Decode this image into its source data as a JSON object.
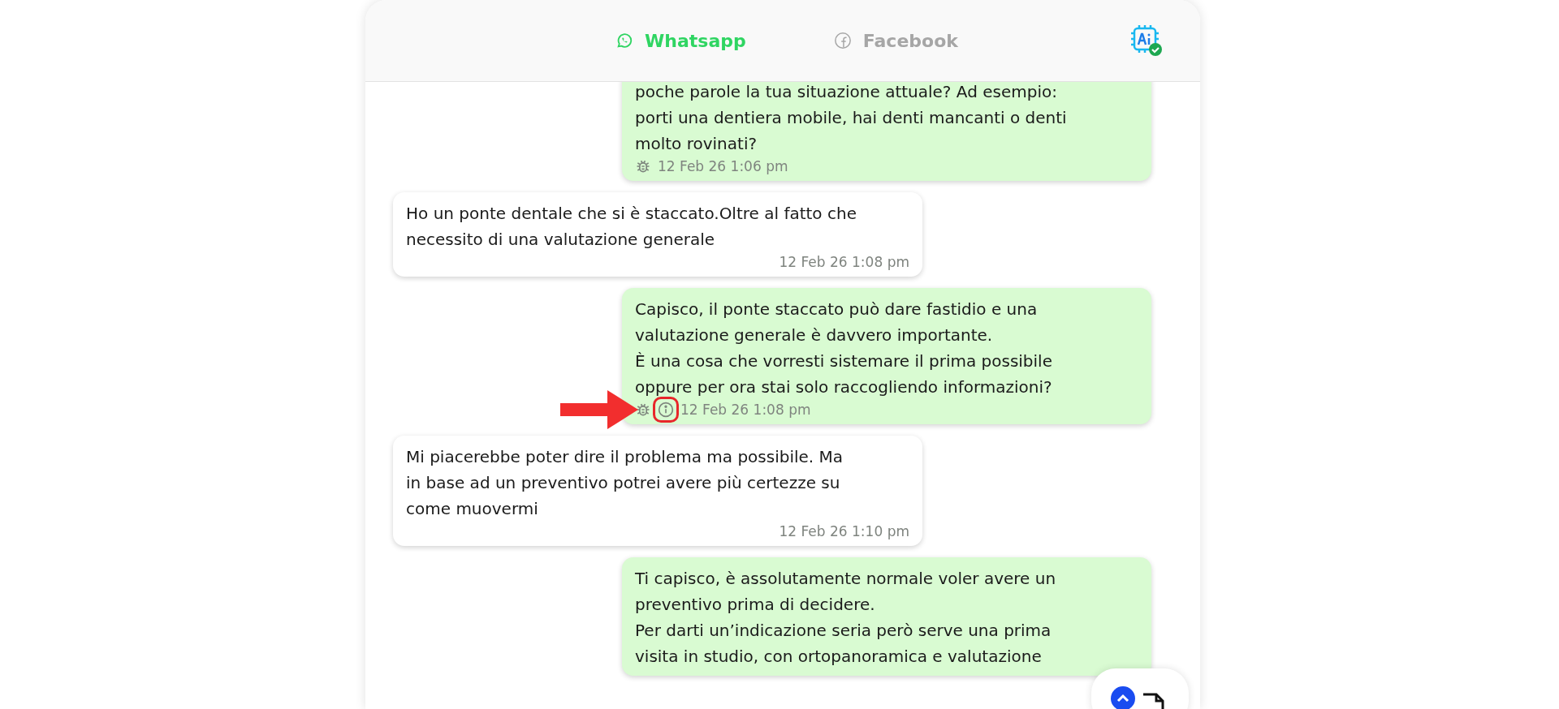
{
  "tabs": [
    {
      "label": "Whatsapp",
      "kind": "whatsapp",
      "selected": true
    },
    {
      "label": "Facebook",
      "kind": "facebook",
      "selected": false
    }
  ],
  "messages": [
    {
      "kind": "sent",
      "lines": [
        "poche parole la tua situazione attuale? Ad esempio:",
        "porti una dentiera mobile, hai denti mancanti o denti",
        "molto rovinati?"
      ],
      "time": "12 Feb 26 1:06 pm",
      "icons": [
        {
          "kind": "bug"
        }
      ]
    },
    {
      "kind": "received",
      "lines": [
        "Ho un ponte dentale che si è staccato.Oltre al fatto che",
        "necessito di una valutazione generale"
      ],
      "time": "12 Feb 26 1:08 pm"
    },
    {
      "kind": "sent",
      "lines": [
        "Capisco, il ponte staccato può dare fastidio e una",
        "valutazione generale è davvero importante.",
        "È una cosa che vorresti sistemare il prima possibile",
        "oppure per ora stai solo raccogliendo informazioni?"
      ],
      "time": "12 Feb 26 1:08 pm",
      "icons": [
        {
          "kind": "bug"
        },
        {
          "kind": "info"
        }
      ],
      "highlighted": true
    },
    {
      "kind": "received",
      "lines": [
        "Mi piacerebbe poter dire il problema ma possibile. Ma",
        "in base ad un preventivo potrei avere più certezze su",
        "come muovermi"
      ],
      "time": "12 Feb 26 1:10 pm"
    },
    {
      "kind": "sent",
      "lines": [
        "Ti capisco, è assolutamente normale voler avere un",
        "preventivo prima di decidere.",
        "Per darti un’indicazione seria però serve una prima",
        "visita in studio, con ortopanoramica e valutazione"
      ]
    }
  ]
}
